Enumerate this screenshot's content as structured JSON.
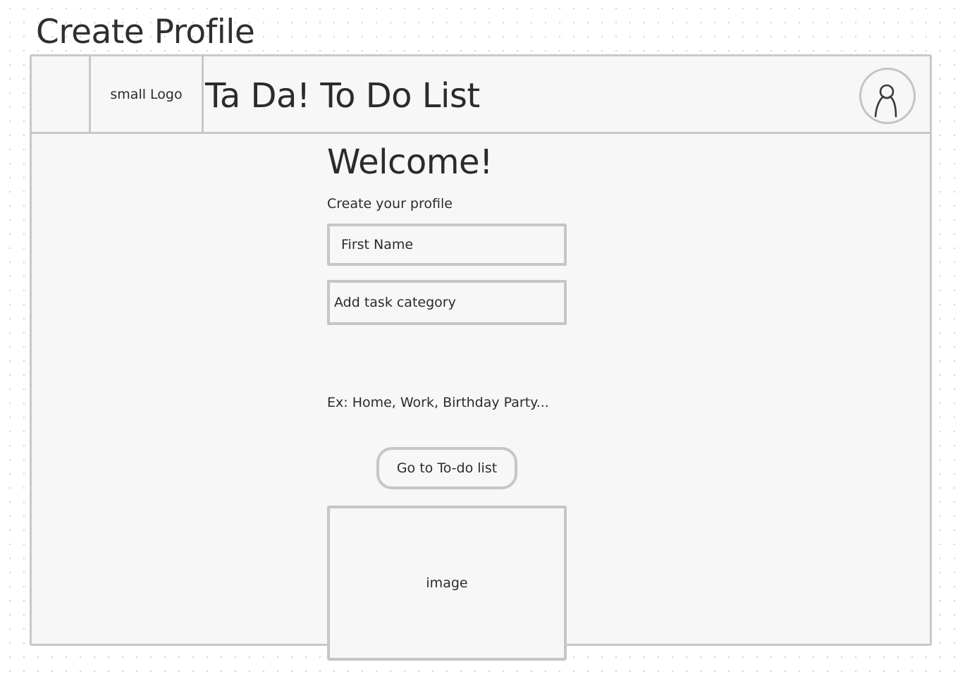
{
  "page": {
    "heading": "Create Profile"
  },
  "header": {
    "logo_label": "small Logo",
    "app_title": "Ta Da! To Do List",
    "avatar_icon": "user-icon"
  },
  "main": {
    "welcome": "Welcome!",
    "subtitle": "Create your profile",
    "first_name": {
      "placeholder": "First Name",
      "value": ""
    },
    "task_category": {
      "placeholder": "Add task category",
      "value": ""
    },
    "example_text": "Ex:  Home, Work, Birthday Party...",
    "go_button_label": "Go to To-do list",
    "image_label": "image"
  },
  "colors": {
    "frame_border": "#c8c8c8",
    "frame_fill": "#f7f7f7",
    "text": "#2b2b2b",
    "canvas_dot": "#d2d2d2"
  }
}
